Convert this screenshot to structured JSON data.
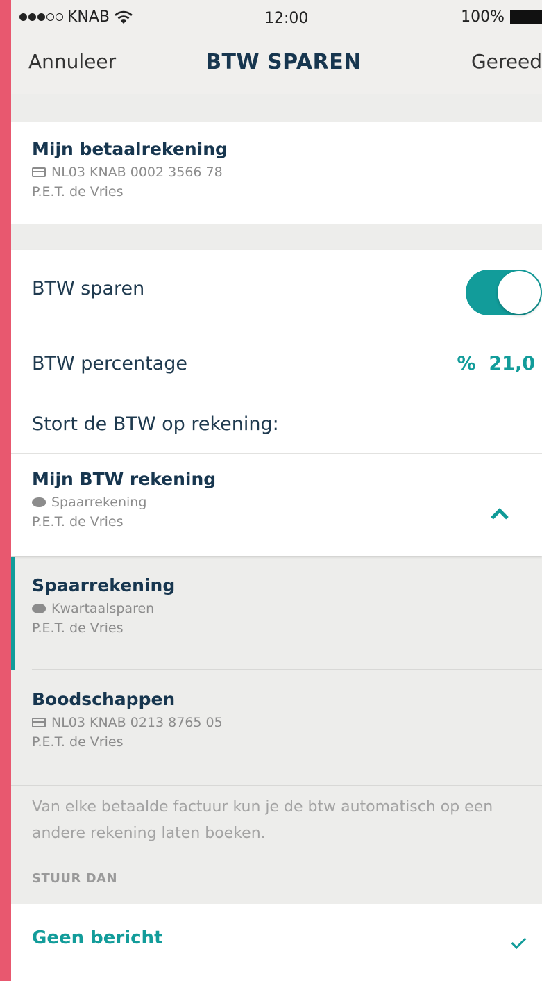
{
  "status_bar": {
    "carrier": "KNAB",
    "signal_full": 3,
    "signal_total": 5,
    "time": "12:00",
    "battery": "100%"
  },
  "nav": {
    "cancel_label": "Annuleer",
    "title": "BTW SPAREN",
    "done_label": "Gereed"
  },
  "source_account": {
    "title": "Mijn betaalrekening",
    "icon": "card-icon",
    "number": "NL03 KNAB 0002 3566 78",
    "owner": "P.E.T. de Vries"
  },
  "settings": {
    "btw_sparen_label": "BTW sparen",
    "btw_sparen_on": true,
    "btw_percentage_label": "BTW percentage",
    "percent_sign": "%",
    "percentage_value": "21,0",
    "deposit_label": "Stort de BTW op rekening:"
  },
  "target_account": {
    "title": "Mijn BTW rekening",
    "icon": "piggy-bank-icon",
    "type": "Spaarrekening",
    "owner": "P.E.T. de Vries",
    "expanded_icon": "chevron-up-icon"
  },
  "account_options": [
    {
      "title": "Spaarrekening",
      "icon": "piggy-bank-icon",
      "sub": "Kwartaalsparen",
      "owner": "P.E.T. de Vries",
      "selected": true
    },
    {
      "title": "Boodschappen",
      "icon": "card-icon",
      "sub": "NL03 KNAB 0213 8765 05",
      "owner": "P.E.T. de Vries",
      "selected": false
    }
  ],
  "info_text": "Van elke betaalde factuur kun je de btw automatisch op een andere rekening laten boeken.",
  "notify_section": {
    "label": "STUUR DAN",
    "option": "Geen bericht",
    "option_checked": true
  },
  "colors": {
    "accent": "#129c9a",
    "title_text": "#17364f",
    "frame": "#e8586f"
  }
}
